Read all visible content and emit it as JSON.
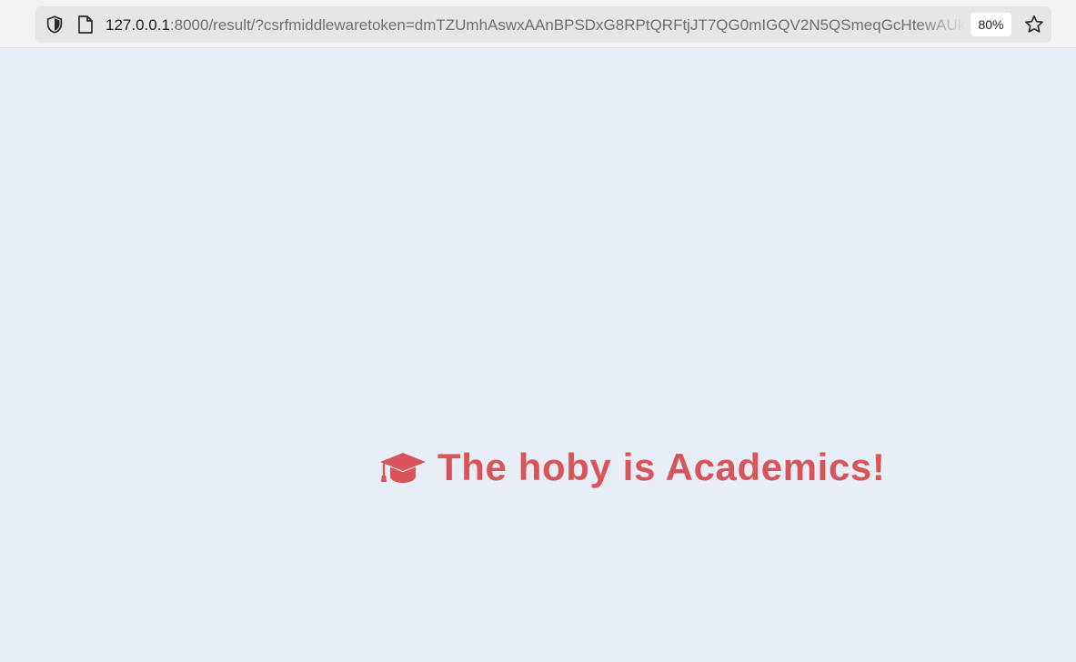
{
  "browser": {
    "url_host": "127.0.0.1",
    "url_rest": ":8000/result/?csrfmiddlewaretoken=dmTZUmhAswxAAnBPSDxG8RPtQRFtjJT7QG0mIGQV2N5QSmeqGcHtewAUkLa",
    "zoom": "80%",
    "icons": {
      "security": "shield-icon",
      "page": "page-icon",
      "bookmark": "star-icon"
    }
  },
  "result": {
    "icon": "graduation-cap-icon",
    "message": "The hoby is Academics!",
    "color": "#d9545a"
  },
  "theme": {
    "page_background": "#e7eef6"
  }
}
